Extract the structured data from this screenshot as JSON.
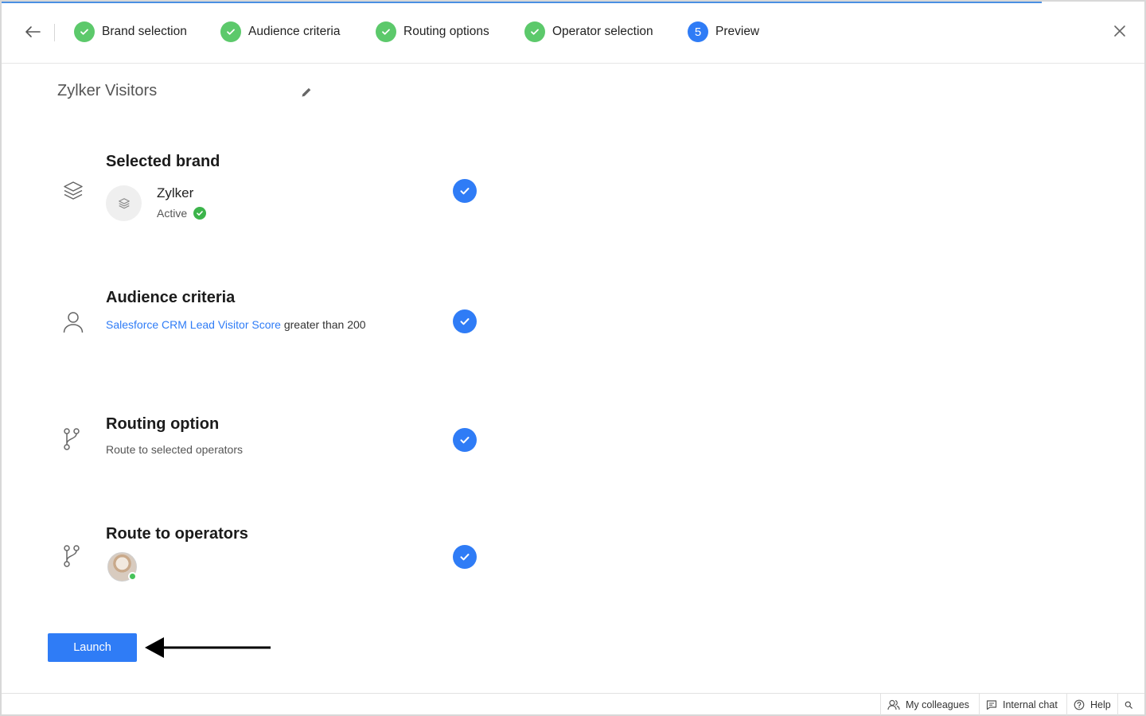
{
  "header": {
    "steps": [
      {
        "label": "Brand selection",
        "state": "done"
      },
      {
        "label": "Audience criteria",
        "state": "done"
      },
      {
        "label": "Routing options",
        "state": "done"
      },
      {
        "label": "Operator selection",
        "state": "done"
      },
      {
        "label": "Preview",
        "state": "current",
        "number": "5"
      }
    ],
    "progress_fraction": 0.91
  },
  "title": "Zylker Visitors",
  "sections": {
    "brand": {
      "title": "Selected brand",
      "name": "Zylker",
      "status": "Active"
    },
    "audience": {
      "title": "Audience criteria",
      "link_text": "Salesforce CRM Lead Visitor Score",
      "condition_text": " greater than 200"
    },
    "routing": {
      "title": "Routing option",
      "text": "Route to selected operators"
    },
    "operators": {
      "title": "Route to operators"
    }
  },
  "launch_label": "Launch",
  "footer": {
    "colleagues": "My colleagues",
    "internal_chat": "Internal chat",
    "help": "Help"
  },
  "colors": {
    "accent": "#2f7cf6",
    "done": "#5cc96b",
    "active_status": "#3cb44b"
  },
  "icons": {
    "back": "arrow-left-icon",
    "close": "close-icon",
    "edit": "pencil-icon",
    "brand": "layers-icon",
    "audience": "user-icon",
    "routing": "branch-icon",
    "search": "search-icon"
  }
}
